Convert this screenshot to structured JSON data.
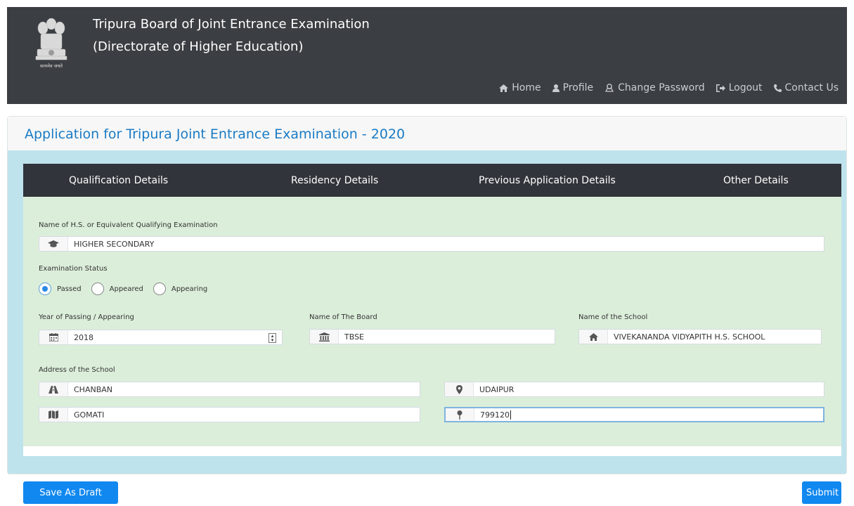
{
  "header": {
    "title_line1": "Tripura Board of Joint Entrance Examination",
    "title_line2": "(Directorate of Higher Education)",
    "emblem_caption": "सत्यमेव जयते",
    "nav": [
      {
        "label": "Home",
        "icon": "home-icon"
      },
      {
        "label": "Profile",
        "icon": "user-icon"
      },
      {
        "label": "Change Password",
        "icon": "key-icon"
      },
      {
        "label": "Logout",
        "icon": "logout-icon"
      },
      {
        "label": "Contact Us",
        "icon": "phone-icon"
      }
    ]
  },
  "page": {
    "title": "Application for Tripura Joint Entrance Examination - 2020"
  },
  "tabs": [
    "Qualification Details",
    "Residency Details",
    "Previous Application Details",
    "Other Details"
  ],
  "form": {
    "qualifying_exam": {
      "label": "Name of H.S. or Equivalent Qualifying Examination",
      "value": "HIGHER SECONDARY",
      "icon": "graduation-cap-icon"
    },
    "exam_status": {
      "label": "Examination Status",
      "options": [
        "Passed",
        "Appeared",
        "Appearing"
      ],
      "selected": "Passed"
    },
    "year": {
      "label": "Year of Passing / Appearing",
      "value": "2018",
      "icon": "calendar-icon"
    },
    "board": {
      "label": "Name of The Board",
      "value": "TBSE",
      "icon": "institution-icon"
    },
    "school": {
      "label": "Name of the School",
      "value": "VIVEKANANDA VIDYAPITH H.S. SCHOOL",
      "icon": "home-icon"
    },
    "address": {
      "label": "Address of the School",
      "locality": {
        "value": "CHANBAN",
        "icon": "road-icon"
      },
      "city": {
        "value": "UDAIPUR",
        "icon": "map-marker-icon"
      },
      "district": {
        "value": "GOMATI",
        "icon": "map-icon"
      },
      "pin": {
        "value": "799120",
        "icon": "pushpin-icon"
      }
    }
  },
  "buttons": {
    "save_draft": "Save As Draft",
    "submit": "Submit"
  },
  "colors": {
    "accent": "#1188f0",
    "title": "#1a7bc4",
    "header_bg": "#3b3e42",
    "form_bg": "#dbeeda",
    "body_bg": "#bfe3ec"
  }
}
